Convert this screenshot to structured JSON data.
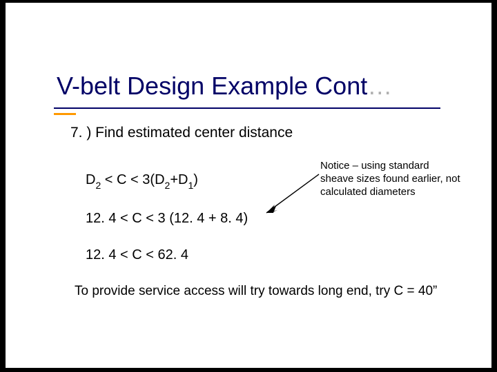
{
  "title": {
    "main": "V-belt Design Example Cont",
    "ellipsis": "…"
  },
  "step": "7. ) Find estimated center distance",
  "eq1": {
    "pre": "D",
    "s1": "2",
    "mid": " < C < 3(D",
    "s2": "2",
    "mid2": "+D",
    "s3": "1",
    "post": ")"
  },
  "eq2": "12. 4 < C < 3 (12. 4 + 8. 4)",
  "eq3": "12. 4 < C < 62. 4",
  "note": "Notice – using standard sheave sizes found earlier, not calculated diameters",
  "closing": {
    "line": "To provide service access will try towards long end, try C = 40",
    "inch": "”"
  }
}
